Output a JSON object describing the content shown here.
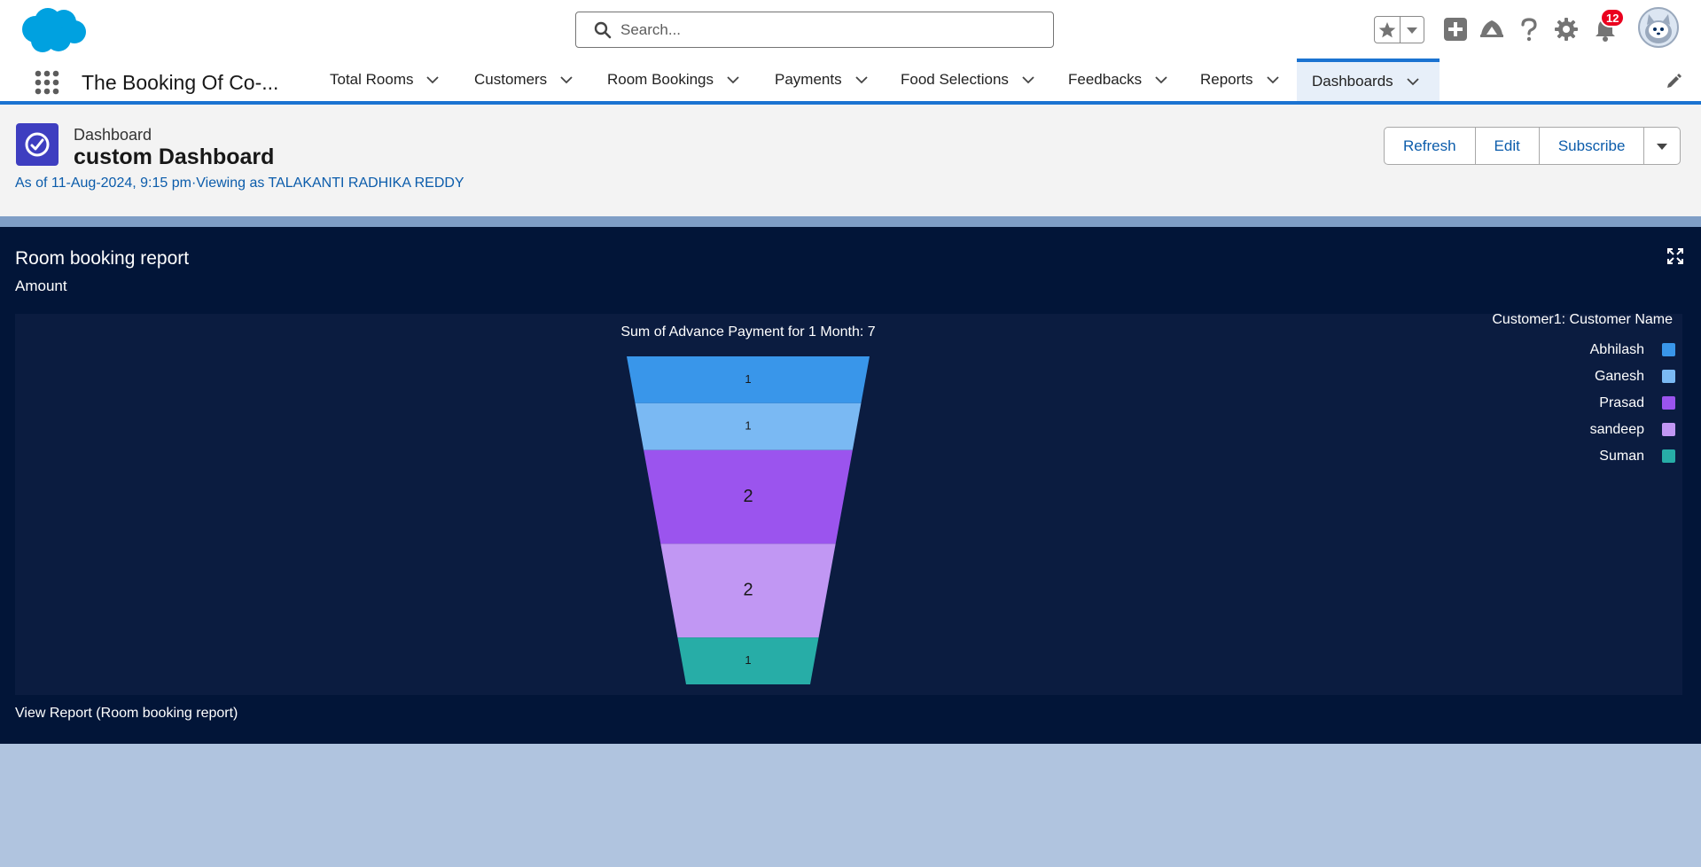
{
  "header": {
    "search_placeholder": "Search...",
    "notification_count": "12"
  },
  "nav": {
    "app_name": "The Booking Of Co-...",
    "tabs": [
      {
        "label": "Total Rooms"
      },
      {
        "label": "Customers"
      },
      {
        "label": "Room Bookings"
      },
      {
        "label": "Payments"
      },
      {
        "label": "Food Selections"
      },
      {
        "label": "Feedbacks"
      },
      {
        "label": "Reports"
      },
      {
        "label": "Dashboards",
        "active": true
      }
    ]
  },
  "page": {
    "object_label": "Dashboard",
    "title": "custom Dashboard",
    "as_of": "As of 11-Aug-2024, 9:15 pm·Viewing as TALAKANTI RADHIKA REDDY",
    "buttons": {
      "refresh": "Refresh",
      "edit": "Edit",
      "subscribe": "Subscribe"
    }
  },
  "component": {
    "title": "Room booking report",
    "subtitle": "Amount",
    "view_report": "View Report (Room booking report)"
  },
  "chart_data": {
    "type": "funnel",
    "title": "Sum of Advance Payment for 1 Month: 7",
    "legend_title": "Customer1: Customer Name",
    "legend_position": "top-right",
    "categories": [
      "Abhilash",
      "Ganesh",
      "Prasad",
      "sandeep",
      "Suman"
    ],
    "values": [
      1,
      1,
      2,
      2,
      1
    ],
    "colors": [
      "#3996ea",
      "#7ab9f3",
      "#9b54ee",
      "#c197f3",
      "#27ada7"
    ]
  },
  "colors": {
    "brand_blue": "#1b73d1",
    "component_bg": "#021538",
    "chart_bg": "#0b1c40",
    "page_bg": "#b0c4df"
  },
  "icons": {
    "logo": "salesforce-cloud-logo",
    "search": "search-icon",
    "favorites": "star-icon",
    "add": "plus-icon",
    "trailhead": "trailhead-icon",
    "help": "question-icon",
    "setup": "gear-icon",
    "notifications": "bell-icon",
    "expand": "expand-icon"
  }
}
